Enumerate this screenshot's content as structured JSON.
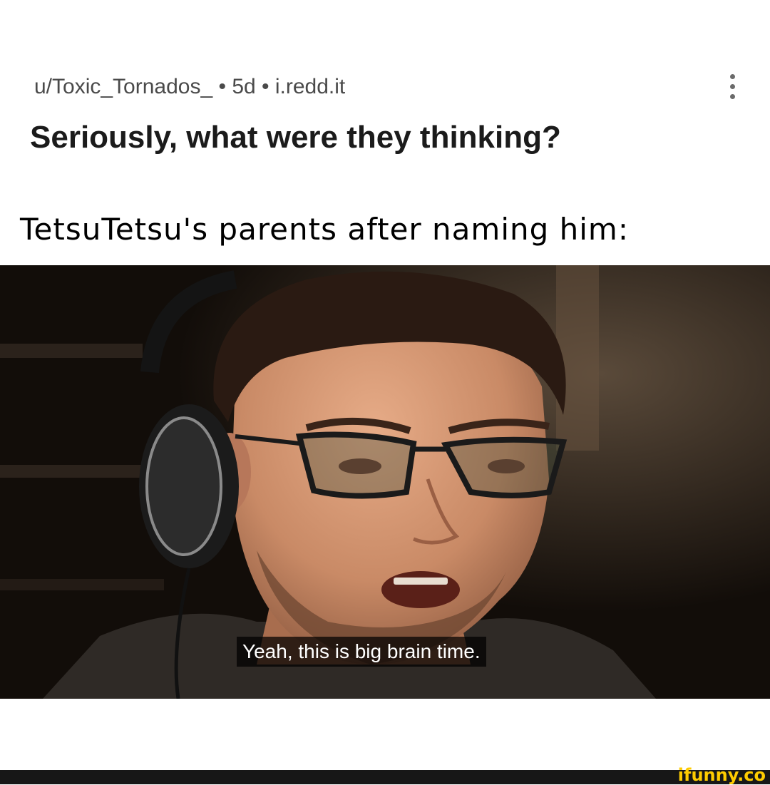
{
  "post": {
    "meta": "u/Toxic_Tornados_ • 5d • i.redd.it",
    "title": "Seriously, what were they thinking?",
    "menu_icon": "kebab-vertical-icon"
  },
  "meme": {
    "caption": "TetsuTetsu's parents after naming him:",
    "subtitle": "Yeah, this is big brain time."
  },
  "watermark": "ifunny.co",
  "colors": {
    "background": "#ffffff",
    "title": "#1b1b1b",
    "meta": "#4a4a4a",
    "footer": "#171717",
    "watermark": "#ffcc00"
  }
}
